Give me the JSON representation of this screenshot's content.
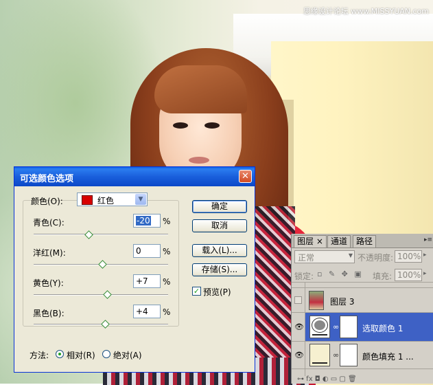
{
  "watermark": "思缘设计论坛 www.MISSYUAN.com",
  "dialog": {
    "title": "可选颜色选项",
    "close_icon": "close-icon",
    "colors_label": "颜色(O):",
    "colors_value": "红色",
    "colors_swatch": "#d80000",
    "sliders": [
      {
        "label": "青色(C):",
        "value": "-20",
        "level": -20
      },
      {
        "label": "洋红(M):",
        "value": "0",
        "level": 0
      },
      {
        "label": "黄色(Y):",
        "value": "+7",
        "level": 7
      },
      {
        "label": "黑色(B):",
        "value": "+4",
        "level": 4
      }
    ],
    "percent": "%",
    "buttons": {
      "ok": "确定",
      "cancel": "取消",
      "load": "载入(L)...",
      "save": "存储(S)..."
    },
    "preview_label": "预览(P)",
    "preview_checked": true,
    "method_label": "方法:",
    "method_relative": "相对(R)",
    "method_absolute": "绝对(A)",
    "method_selected": "relative"
  },
  "layers_panel": {
    "tabs": [
      "图层",
      "通道",
      "路径"
    ],
    "tab_close": "×",
    "blend_mode": "正常",
    "opacity_label": "不透明度:",
    "opacity_value": "100%",
    "lock_label": "锁定:",
    "fill_label": "填充:",
    "fill_value": "100%",
    "layers": [
      {
        "name": "图层 3",
        "visible": false,
        "selected": false
      },
      {
        "name": "选取颜色 1",
        "visible": true,
        "selected": true
      },
      {
        "name": "颜色填充 1 ...",
        "visible": true,
        "selected": false
      }
    ],
    "accent": "#3e61c5"
  }
}
